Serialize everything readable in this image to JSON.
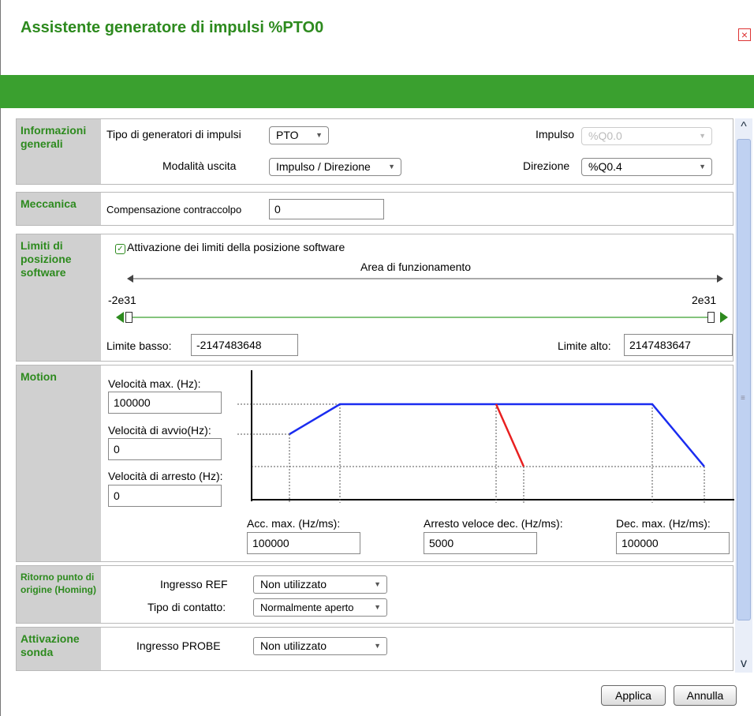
{
  "window": {
    "title": "Assistente generatore di impulsi %PTO0",
    "close_glyph": "×"
  },
  "general": {
    "label": "Informazioni generali",
    "generator_type_label": "Tipo di generatori di impulsi",
    "generator_type_value": "PTO",
    "output_mode_label": "Modalità uscita",
    "output_mode_value": "Impulso / Direzione",
    "pulse_label": "Impulso",
    "pulse_value": "%Q0.0",
    "direction_label": "Direzione",
    "direction_value": "%Q0.4"
  },
  "mechanics": {
    "label": "Meccanica",
    "backlash_label": "Compensazione contraccolpo",
    "backlash_value": "0"
  },
  "software_limits": {
    "label": "Limiti di posizione software",
    "enable_label": "Attivazione dei limiti della posizione software",
    "enabled": true,
    "area_label": "Area di funzionamento",
    "min_label": "-2e31",
    "max_label": "2e31",
    "low_limit_label": "Limite basso:",
    "low_limit_value": "-2147483648",
    "high_limit_label": "Limite alto:",
    "high_limit_value": "2147483647"
  },
  "motion": {
    "label": "Motion",
    "max_speed_label": "Velocità max. (Hz):",
    "max_speed_value": "100000",
    "start_speed_label": "Velocità di avvio(Hz):",
    "start_speed_value": "0",
    "stop_speed_label": "Velocità di arresto (Hz):",
    "stop_speed_value": "0",
    "acc_label": "Acc. max. (Hz/ms):",
    "acc_value": "100000",
    "fast_stop_label": "Arresto veloce dec. (Hz/ms):",
    "fast_stop_value": "5000",
    "dec_label": "Dec. max. (Hz/ms):",
    "dec_value": "100000",
    "profile_color": "#1a2cf0",
    "fast_stop_color": "#e82020"
  },
  "homing": {
    "label": "Ritorno punto di origine (Homing)",
    "ref_input_label": "Ingresso REF",
    "ref_input_value": "Non utilizzato",
    "contact_type_label": "Tipo di contatto:",
    "contact_type_value": "Normalmente aperto"
  },
  "probe": {
    "label": "Attivazione sonda",
    "probe_input_label": "Ingresso PROBE",
    "probe_input_value": "Non utilizzato"
  },
  "buttons": {
    "apply": "Applica",
    "cancel": "Annulla"
  },
  "colors": {
    "accent": "#2d8a1e",
    "header_bar": "#3aa02f"
  },
  "icons": {
    "dropdown": "▼",
    "scroll_up": "^",
    "scroll_down": "v"
  }
}
